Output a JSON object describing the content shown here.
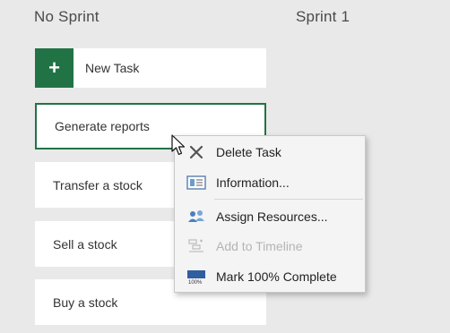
{
  "board": {
    "columns": [
      {
        "title": "No Sprint"
      },
      {
        "title": "Sprint 1"
      }
    ],
    "new_task": {
      "plus": "+",
      "label": "New Task"
    },
    "tasks": [
      {
        "name": "Generate reports",
        "selected": true
      },
      {
        "name": "Transfer a stock"
      },
      {
        "name": "Sell a stock"
      },
      {
        "name": "Buy a stock"
      }
    ]
  },
  "context_menu": {
    "items": [
      {
        "label": "Delete Task",
        "icon": "delete-icon",
        "enabled": true
      },
      {
        "label": "Information...",
        "icon": "information-icon",
        "enabled": true
      },
      {
        "label": "Assign Resources...",
        "icon": "assign-resources-icon",
        "enabled": true
      },
      {
        "label": "Add to Timeline",
        "icon": "add-to-timeline-icon",
        "enabled": false
      },
      {
        "label": "Mark 100% Complete",
        "icon": "mark-complete-icon",
        "enabled": true
      }
    ]
  },
  "colors": {
    "accent": "#217346",
    "background": "#e9e9e9",
    "menu_background": "#f4f4f4"
  }
}
